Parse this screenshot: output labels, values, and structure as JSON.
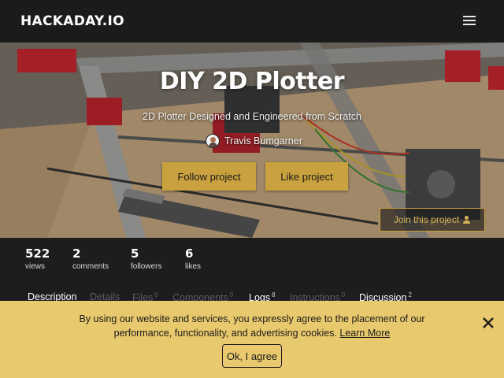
{
  "nav": {
    "logo": "HACKADAY.IO",
    "menu_icon": "hamburger-menu-icon"
  },
  "hero": {
    "title": "DIY 2D Plotter",
    "subtitle": "2D Plotter Designed and Engineered from Scratch",
    "author": "Travis Bumgarner",
    "follow_label": "Follow project",
    "like_label": "Like project",
    "join_label": "Join this project",
    "join_icon": "person-add-icon"
  },
  "stats": [
    {
      "num": "522",
      "label": "views"
    },
    {
      "num": "2",
      "label": "comments"
    },
    {
      "num": "5",
      "label": "followers"
    },
    {
      "num": "6",
      "label": "likes"
    }
  ],
  "tabs": [
    {
      "label": "Description",
      "count": "",
      "active": true
    },
    {
      "label": "Details",
      "count": "",
      "active": false
    },
    {
      "label": "Files",
      "count": "0",
      "active": false
    },
    {
      "label": "Components",
      "count": "0",
      "active": false
    },
    {
      "label": "Logs",
      "count": "8",
      "active": true
    },
    {
      "label": "Instructions",
      "count": "0",
      "active": false
    },
    {
      "label": "Discussion",
      "count": "2",
      "active": true
    }
  ],
  "cookie": {
    "text": "By using our website and services, you expressly agree to the placement of our performance, functionality, and advertising cookies.",
    "link_label": "Learn More",
    "ok_label": "Ok, I agree",
    "close_icon": "close-icon"
  },
  "colors": {
    "accent": "#c9a13e",
    "cookie_bg": "#e9c96d",
    "nav_bg": "#1b1b1b"
  }
}
